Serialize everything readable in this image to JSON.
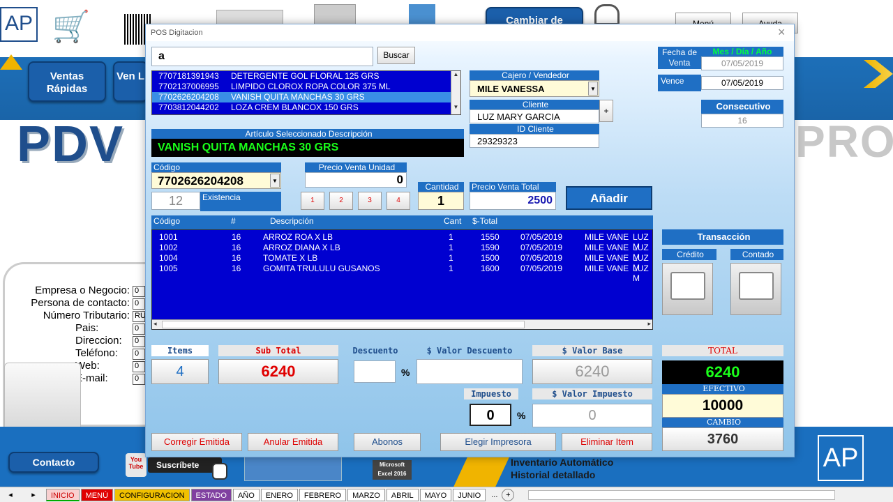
{
  "bg": {
    "btn_ventas_rapidas": "Ventas Rápidas",
    "btn_ventas_2": "Ven L",
    "btn_cambiar": "Cambiar de",
    "btn_menu": "Menú",
    "btn_ayuda": "Ayuda",
    "logo_ap": "AP",
    "pdv_title": "PDV",
    "pro_title": "PRO",
    "info_labels": [
      "Empresa o Negocio:",
      "Persona de contacto:",
      "Número Tributario:",
      "Pais:",
      "Direccion:",
      "Teléfono:",
      "Web:",
      "E-mail:"
    ],
    "info_values": [
      "0",
      "0",
      "RU",
      "0",
      "0",
      "0",
      "0",
      "0"
    ],
    "contacto": "Contacto",
    "youtube": "You Tube",
    "suscribete": "Suscríbete",
    "excel_label": "Microsoft Excel 2016",
    "inventario_1": "Inventario Automático",
    "inventario_2": "Historial detallado",
    "sheet_tabs": [
      "INICIO",
      "MENÚ",
      "CONFIGURACION",
      "ESTADO",
      "AÑO",
      "ENERO",
      "FEBRERO",
      "MARZO",
      "ABRIL",
      "MAYO",
      "JUNIO",
      "..."
    ]
  },
  "dialog": {
    "title": "POS Digitacion",
    "close": "×",
    "search_value": "a",
    "search_button": "Buscar",
    "product_list": [
      {
        "code": "7707181391943",
        "desc": "DETERGENTE GOL FLORAL 125 GRS"
      },
      {
        "code": "7702137006995",
        "desc": "LIMPIDO CLOROX ROPA COLOR 375 ML"
      },
      {
        "code": "7702626204208",
        "desc": "VANISH QUITA MANCHAS 30 GRS"
      },
      {
        "code": "7703812044202",
        "desc": "LOZA CREM BLANCOX 150 GRS"
      }
    ],
    "articulo_label": "Artículo Seleccionado Descripción",
    "articulo_value": "VANISH QUITA MANCHAS 30 GRS",
    "cajero_label": "Cajero / Vendedor",
    "cajero_value": "MILE VANESSA",
    "cliente_label": "Cliente",
    "cliente_value": "LUZ MARY GARCIA",
    "add_cliente": "+",
    "id_cliente_label": "ID Cliente",
    "id_cliente_value": "29329323",
    "fecha_label": "Fecha de Venta",
    "fecha_format": "Mes / Día / Año",
    "fecha_value": "07/05/2019",
    "vence_label": "Vence",
    "vence_value": "07/05/2019",
    "consecutivo_label": "Consecutivo",
    "consecutivo_value": "16",
    "codigo_label": "Código",
    "codigo_value": "7702626204208",
    "existencia_value": "12",
    "existencia_label": "Existencia",
    "precio_unidad_label": "Precio Venta Unidad",
    "precio_unidad_value": "0",
    "qty_buttons": [
      "1",
      "2",
      "3",
      "4"
    ],
    "cantidad_label": "Cantidad",
    "cantidad_value": "1",
    "precio_total_label": "Precio Venta  Total",
    "precio_total_value": "2500",
    "anadir": "Añadir",
    "grid_headers": [
      "Código",
      "#",
      "Descripción",
      "Cant",
      "$-Total"
    ],
    "grid_rows": [
      [
        "1001",
        "16",
        "ARROZ ROA X LB",
        "1",
        "1550",
        "07/05/2019",
        "MILE VANE",
        "LUZ M"
      ],
      [
        "1002",
        "16",
        "ARROZ DIANA X LB",
        "1",
        "1590",
        "07/05/2019",
        "MILE VANE",
        "LUZ M"
      ],
      [
        "1004",
        "16",
        "TOMATE X LB",
        "1",
        "1500",
        "07/05/2019",
        "MILE VANE",
        "LUZ M"
      ],
      [
        "1005",
        "16",
        "GOMITA TRULULU GUSANOS",
        "1",
        "1600",
        "07/05/2019",
        "MILE VANE",
        "LUZ M"
      ]
    ],
    "transaccion_label": "Transacción",
    "credito_label": "Crédito",
    "contado_label": "Contado",
    "items_label": "Items",
    "items_value": "4",
    "subtotal_label": "Sub Total",
    "subtotal_value": "6240",
    "descuento_label": "Descuento",
    "descuento_value": "",
    "pct": "%",
    "valor_descuento_label": "$ Valor Descuento",
    "valor_descuento_value": "",
    "valor_base_label": "$ Valor Base",
    "valor_base_value": "6240",
    "impuesto_label": "Impuesto",
    "impuesto_value": "0",
    "valor_impuesto_label": "$ Valor Impuesto",
    "valor_impuesto_value": "0",
    "total_label": "TOTAL",
    "total_value": "6240",
    "efectivo_label": "EFECTIVO",
    "efectivo_value": "10000",
    "cambio_label": "CAMBIO",
    "cambio_value": "3760",
    "actions": [
      "Corregir Emitida",
      "Anular Emitida",
      "Abonos",
      "Elegir Impresora",
      "Eliminar Item"
    ]
  },
  "colors": {
    "list_blue": "#0000d0",
    "label_blue": "#1f6fc4",
    "total_green": "#00ff40",
    "red_text": "#e00000"
  }
}
